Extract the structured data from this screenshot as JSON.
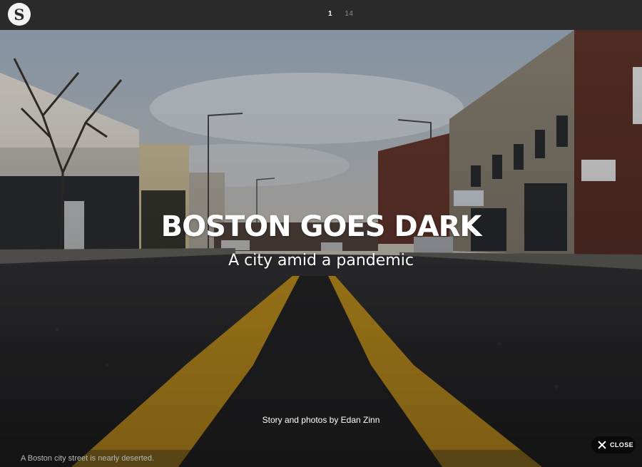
{
  "header": {
    "logo_letter": "S",
    "pager": {
      "current": "1",
      "total": "14"
    }
  },
  "story": {
    "title": "BOSTON GOES DARK",
    "subtitle": "A city amid a pandemic",
    "byline": "Story and photos by Edan Zinn",
    "caption": "A Boston city street is nearly deserted."
  },
  "controls": {
    "close_label": "CLOSE"
  },
  "colors": {
    "topbar": "#2a2a2a",
    "road": "#2c2c2e",
    "center_line": "#d9a322",
    "sky": "#b9c2cc"
  },
  "icons": [
    "close-icon"
  ]
}
